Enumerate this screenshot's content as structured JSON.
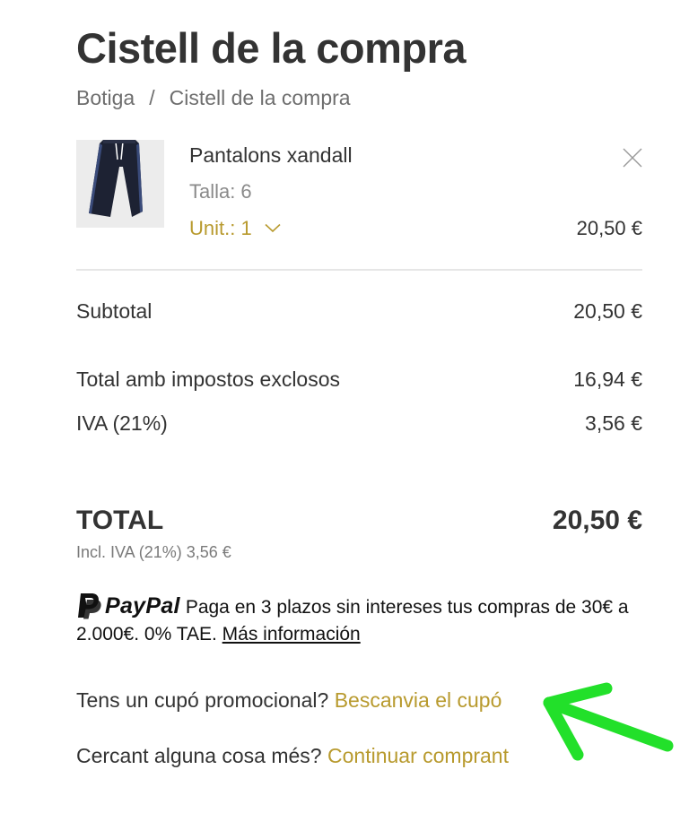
{
  "page": {
    "title": "Cistell de la compra"
  },
  "breadcrumb": {
    "home": "Botiga",
    "separator": "/",
    "current": "Cistell de la compra"
  },
  "cart_item": {
    "name": "Pantalons xandall",
    "size_label": "Talla:",
    "size_value": "6",
    "quantity_label": "Unit.: 1",
    "price": "20,50 €",
    "thumbnail_icon": "tracksuit-pants-image",
    "remove_icon": "close-icon"
  },
  "summary": {
    "subtotal_label": "Subtotal",
    "subtotal_value": "20,50 €",
    "excl_label": "Total amb impostos exclosos",
    "excl_value": "16,94 €",
    "iva_label": "IVA (21%)",
    "iva_value": "3,56 €",
    "total_label": "TOTAL",
    "total_value": "20,50 €",
    "total_note": "Incl. IVA (21%) 3,56 €"
  },
  "paypal": {
    "brand": "PayPal",
    "message": "Paga en 3 plazos sin intereses tus compras de 30€ a 2.000€. 0% TAE.",
    "link": "Más información"
  },
  "promo": {
    "question": "Tens un cupó promocional?",
    "link": "Bescanvia el cupó"
  },
  "continue": {
    "question": "Cercant alguna cosa més?",
    "link": "Continuar comprant"
  },
  "colors": {
    "accent_gold": "#b89a2e",
    "text_dark": "#333333",
    "text_muted": "#8a8a8a",
    "annotation_arrow": "#22e02a"
  }
}
